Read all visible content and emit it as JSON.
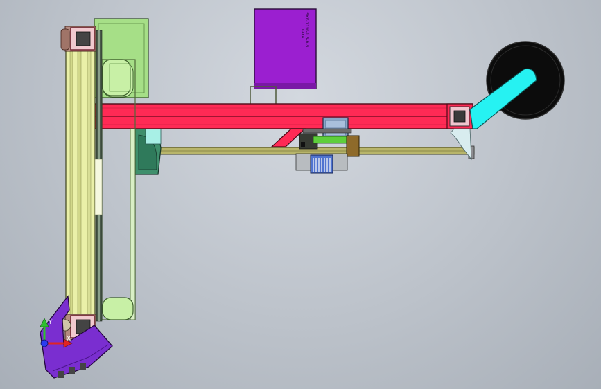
{
  "viewport": {
    "name": "cad-graphics-area",
    "background_top": "#d3d8df",
    "background_bottom": "#a8afb8"
  },
  "box_label": {
    "line1": "SKF-11W-1.5-R-5",
    "line2": "KAKA"
  },
  "triad": {
    "y_label": "Y",
    "x_label": "X"
  },
  "colors": {
    "frame_red": "#ff2a55",
    "column_yellow": "#eaf0a8",
    "bracket_green": "#a8e088",
    "motor_purple": "#9b1fd0",
    "arm_cyan": "#26f2f2",
    "wheel_black": "#0c0c0c",
    "base_purple": "#7a2ed0",
    "rail_olive": "#b8b56a"
  }
}
